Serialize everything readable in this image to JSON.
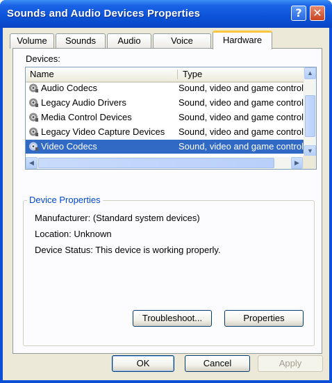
{
  "window": {
    "title": "Sounds and Audio Devices Properties"
  },
  "titlebar": {
    "help_label": "?",
    "close_label": "✕"
  },
  "tabs": [
    {
      "label": "Volume"
    },
    {
      "label": "Sounds"
    },
    {
      "label": "Audio"
    },
    {
      "label": "Voice"
    },
    {
      "label": "Hardware"
    }
  ],
  "active_tab": "Hardware",
  "devices": {
    "label": "Devices:",
    "columns": [
      "Name",
      "Type"
    ],
    "rows": [
      {
        "name": "Audio Codecs",
        "type": "Sound, video and game controllers"
      },
      {
        "name": "Legacy Audio Drivers",
        "type": "Sound, video and game controllers"
      },
      {
        "name": "Media Control Devices",
        "type": "Sound, video and game controllers"
      },
      {
        "name": "Legacy Video Capture Devices",
        "type": "Sound, video and game controllers"
      },
      {
        "name": "Video Codecs",
        "type": "Sound, video and game controllers"
      }
    ],
    "selected_row": "Video Codecs"
  },
  "device_properties": {
    "title": "Device Properties",
    "manufacturer": "Manufacturer: (Standard system devices)",
    "location": "Location: Unknown",
    "status": "Device Status: This device is working properly."
  },
  "buttons": {
    "troubleshoot": "Troubleshoot...",
    "properties": "Properties",
    "ok": "OK",
    "cancel": "Cancel",
    "apply": "Apply"
  },
  "colors": {
    "titlebar": "#0a4fd6",
    "selection": "#316ac5",
    "group_title": "#0046d5",
    "tab_highlight": "#ffc83c"
  }
}
